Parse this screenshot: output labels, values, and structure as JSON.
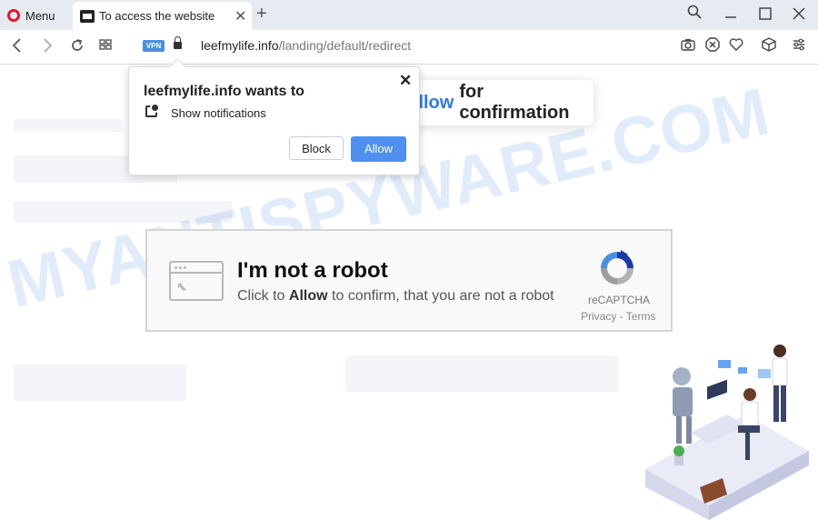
{
  "browser": {
    "menu_label": "Menu",
    "tab_title": "To access the website",
    "tab_close_glyph": "✕",
    "new_tab_glyph": "+",
    "window_controls": [
      "search-icon",
      "minimize-icon",
      "maximize-icon",
      "close-icon"
    ]
  },
  "addressbar": {
    "vpn_label": "VPN",
    "url_host": "leefmylife.info",
    "url_path": "/landing/default/redirect",
    "tools": [
      "camera-icon",
      "adblock-icon",
      "heart-icon",
      "cube-icon",
      "settings-icon"
    ]
  },
  "page": {
    "press_card": {
      "highlight": "Allow",
      "rest": "for confirmation"
    },
    "watermark": "MYANTISPYWARE.COM",
    "captcha": {
      "title": "I'm not a robot",
      "sub_pre": "Click to ",
      "sub_bold": "Allow",
      "sub_post": " to confirm, that you are not a robot",
      "brand": "reCAPTCHA",
      "links": "Privacy - Terms"
    }
  },
  "popup": {
    "title": "leefmylife.info wants to",
    "message": "Show notifications",
    "close_glyph": "✕",
    "block_label": "Block",
    "allow_label": "Allow"
  },
  "colors": {
    "accent": "#4e8ff0",
    "opera_red": "#e0182d",
    "watermark": "#508ce6"
  }
}
